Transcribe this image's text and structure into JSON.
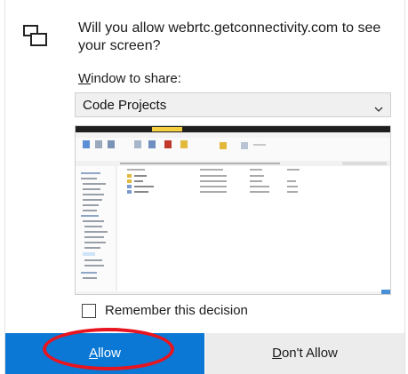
{
  "dialog": {
    "prompt": "Will you allow webrtc.getconnectivity.com to see your screen?",
    "window_label_accesskey": "W",
    "window_label_rest": "indow to share:",
    "selected_window": "Code Projects",
    "remember_label": "Remember this decision",
    "remember_checked": false,
    "allow_accesskey": "A",
    "allow_rest": "llow",
    "deny_accesskey": "D",
    "deny_rest": "on't Allow",
    "colors": {
      "allow_button": "#0a78d4",
      "deny_button": "#ececec",
      "highlight_circle": "#e8141f"
    },
    "icons": [
      "screen-share-icon",
      "chevron-down-icon"
    ]
  }
}
